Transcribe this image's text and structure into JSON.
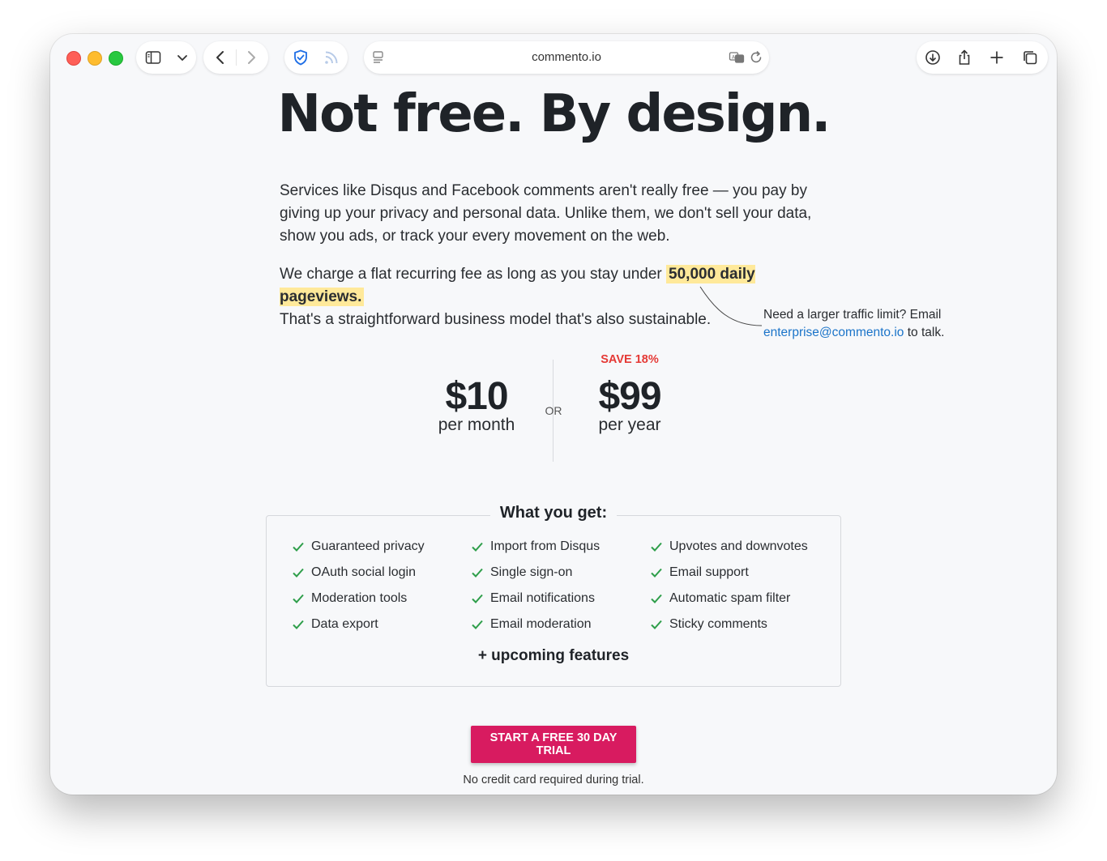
{
  "browser": {
    "address": "commento.io"
  },
  "hero": {
    "headline": "Not free. By design.",
    "paragraph1": "Services like Disqus and Facebook comments aren't really free — you pay by giving up your privacy and personal data. Unlike them, we don't sell your data, show you ads, or track your every movement on the web.",
    "paragraph2_pre": "We charge a flat recurring fee as long as you stay under ",
    "paragraph2_highlight": "50,000 daily pageviews.",
    "paragraph2_post": "That's a straightforward business model that's also sustainable."
  },
  "callout": {
    "pre": "Need a larger traffic limit? Email",
    "email": "enterprise@commento.io",
    "post": " to talk."
  },
  "pricing": {
    "monthly_amount": "$10",
    "monthly_label": "per month",
    "or_label": "OR",
    "save_badge": "SAVE 18%",
    "yearly_amount": "$99",
    "yearly_label": "per year"
  },
  "features": {
    "title": "What you get:",
    "col1": [
      "Guaranteed privacy",
      "OAuth social login",
      "Moderation tools",
      "Data export"
    ],
    "col2": [
      "Import from Disqus",
      "Single sign-on",
      "Email notifications",
      "Email moderation"
    ],
    "col3": [
      "Upvotes and downvotes",
      "Email support",
      "Automatic spam filter",
      "Sticky comments"
    ],
    "upcoming": "+ upcoming features"
  },
  "cta": {
    "button": "START A FREE 30 DAY TRIAL",
    "note": "No credit card required during trial."
  },
  "colors": {
    "accent": "#d81b60",
    "highlight": "#ffe99a",
    "save": "#e53935",
    "check": "#2e9e4a",
    "link": "#1b74c9"
  }
}
